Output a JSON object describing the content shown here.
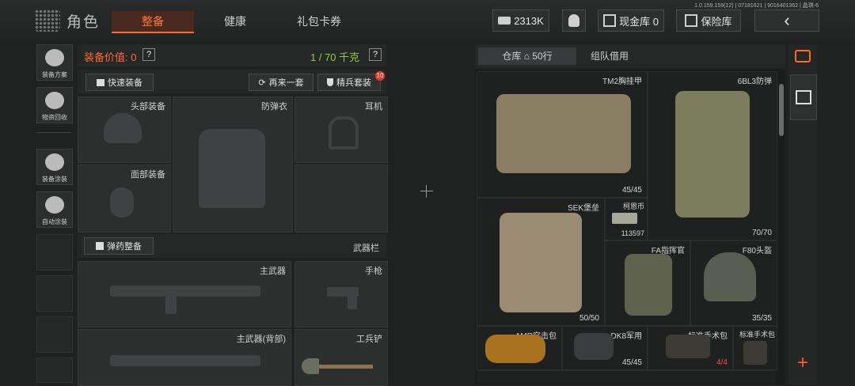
{
  "header": {
    "title": "角色",
    "tabs": [
      {
        "label": "整备",
        "active": true
      },
      {
        "label": "健康",
        "active": false
      },
      {
        "label": "礼包卡券",
        "active": false
      }
    ],
    "money": "2313K",
    "cash_vault": "现金库 0",
    "safe": "保险库",
    "version": "1.0.159.159(12) | 07181621 | 9016401362 | 晶琪-6"
  },
  "sidebar": {
    "items": [
      {
        "label": "装备方案",
        "icon": "gear-loadout-icon"
      },
      {
        "label": "物资回收",
        "icon": "recycle-icon"
      },
      {
        "label": "装备涂装",
        "icon": "paint-icon"
      },
      {
        "label": "自动涂装",
        "icon": "auto-paint-icon"
      }
    ]
  },
  "equipment": {
    "value_label": "装备价值: 0",
    "help": "?",
    "weight": "1 / 70 千克",
    "quick_equip": "快速装备",
    "repeat": "再来一套",
    "elite": "精兵套装",
    "elite_badge": "10",
    "slots": {
      "head": "头部装备",
      "armor": "防弹衣",
      "ear": "耳机",
      "face": "面部装备"
    },
    "ammo_btn": "弹药整备",
    "weapon_bar": "武器栏",
    "weapon_slots": {
      "primary": "主武器",
      "pistol": "手枪",
      "primary_back": "主武器(背部)",
      "shovel": "工兵铲"
    }
  },
  "warehouse": {
    "tabs": [
      {
        "label": "仓库",
        "rows": "50行"
      },
      {
        "label": "组队借用"
      }
    ],
    "items": [
      {
        "name": "TM2胸挂甲",
        "count": "45/45",
        "color": "#8a7e62"
      },
      {
        "name": "6BL3防弹",
        "count": "70/70",
        "color": "#7b7d5c"
      },
      {
        "name": "SEK堡垒",
        "count": "50/50",
        "color": "#9a8c72"
      },
      {
        "name": "柯恩币",
        "count": "113597",
        "color": "#a8a89a"
      },
      {
        "name": "FA指挥官",
        "count": "",
        "color": "#5f624c"
      },
      {
        "name": "F80头盔",
        "count": "35/35",
        "color": "#5a5e52"
      },
      {
        "name": "AMR突击包",
        "count": "",
        "color": "#a8721e"
      },
      {
        "name": "DK8军用",
        "count": "45/45",
        "color": "#3a3d3e"
      },
      {
        "name": "标准手术包",
        "count": "4/4",
        "color": "#3d3b35"
      },
      {
        "name": "标准手术包",
        "count": "",
        "color": "#3d3b35"
      }
    ],
    "plus": "+"
  }
}
